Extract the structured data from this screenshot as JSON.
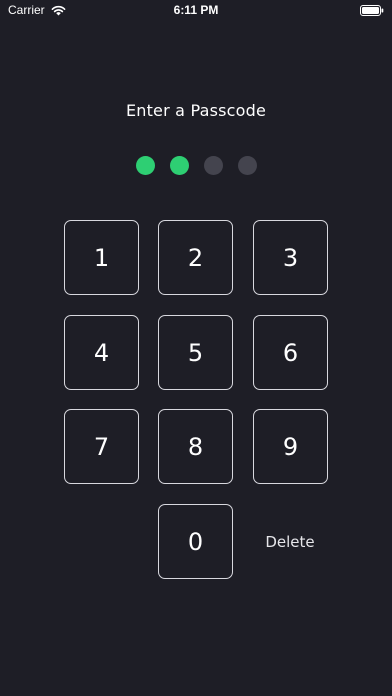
{
  "status_bar": {
    "carrier": "Carrier",
    "time": "6:11 PM",
    "icons": [
      "wifi-icon",
      "battery-icon"
    ]
  },
  "title": "Enter a Passcode",
  "passcode": {
    "length": 4,
    "entered": 2,
    "filled_color": "#2ecf73",
    "empty_color": "#44444e"
  },
  "keypad": {
    "keys": [
      "1",
      "2",
      "3",
      "4",
      "5",
      "6",
      "7",
      "8",
      "9",
      "0"
    ],
    "delete_label": "Delete"
  },
  "colors": {
    "background": "#1e1e26",
    "key_border": "#d8d8de",
    "text": "#ffffff"
  }
}
